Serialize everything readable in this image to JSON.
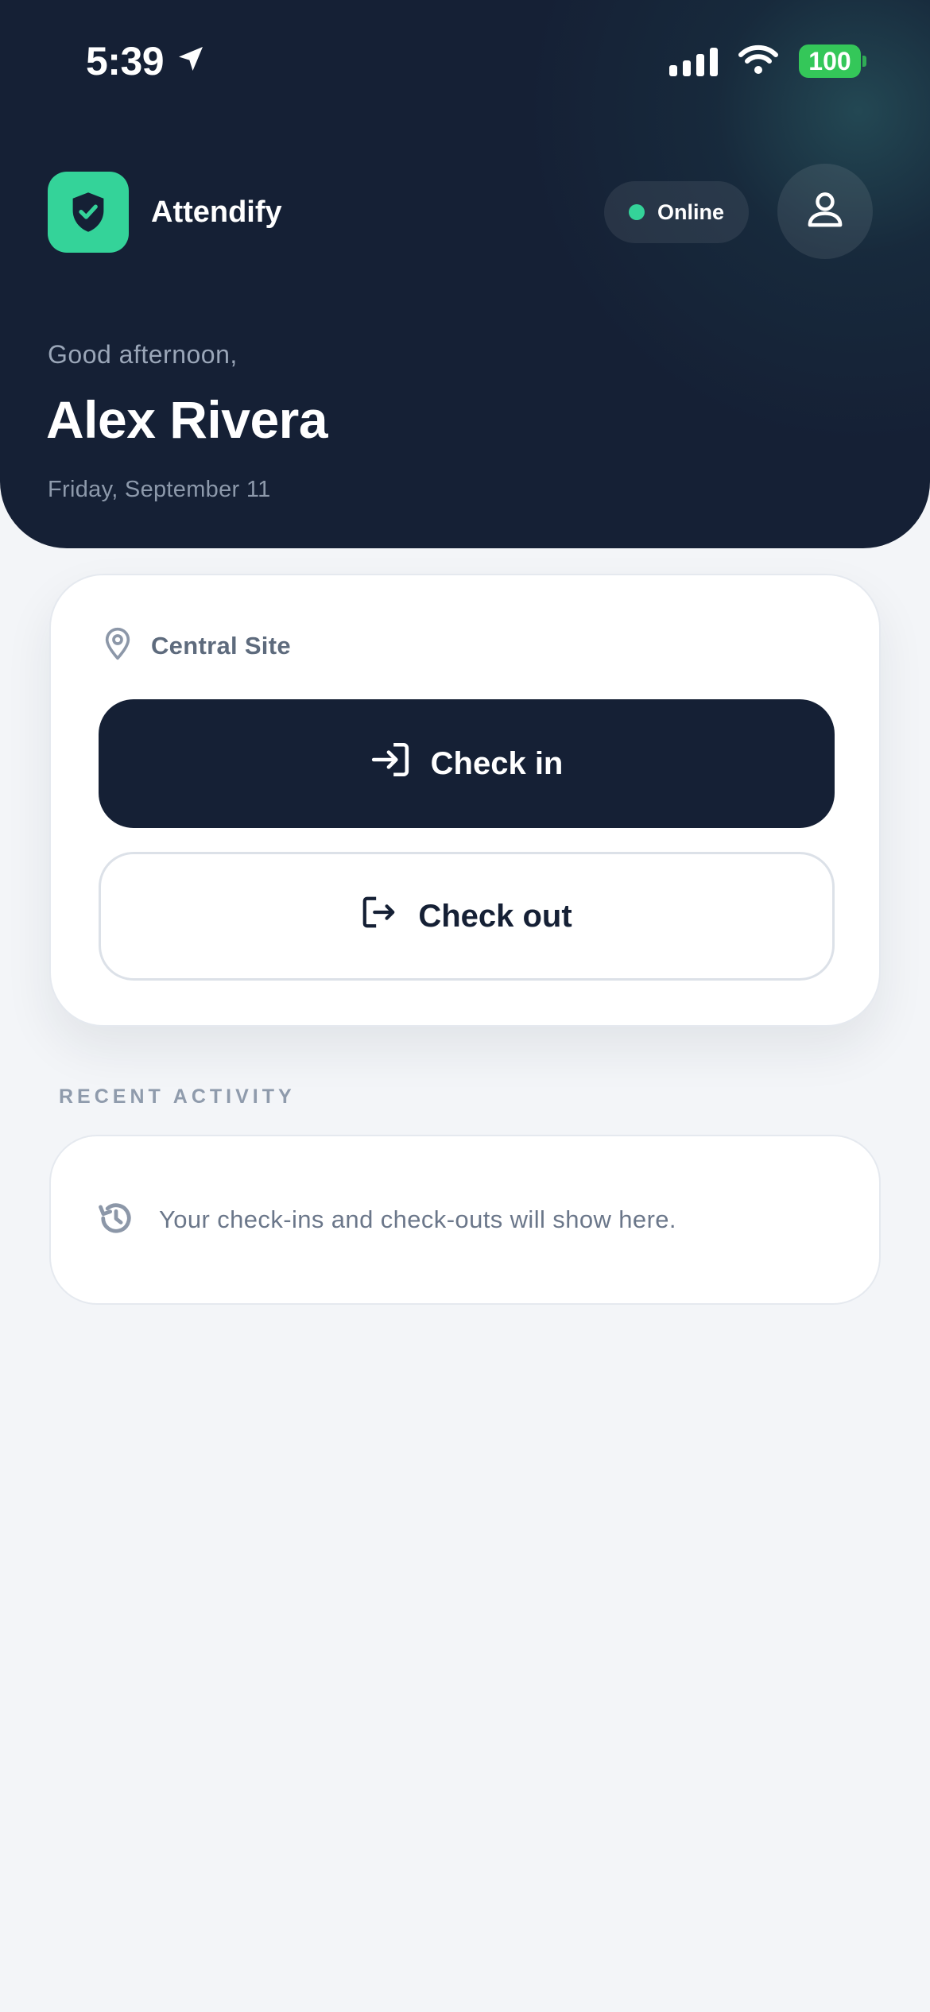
{
  "status_bar": {
    "time": "5:39",
    "battery": "100"
  },
  "header": {
    "app_name": "Attendify",
    "status_label": "Online",
    "greeting": "Good afternoon,",
    "user_name": "Alex Rivera",
    "date": "Friday, September 11"
  },
  "attendance": {
    "site": "Central Site",
    "check_in_label": "Check in",
    "check_out_label": "Check out"
  },
  "recent_activity": {
    "title": "RECENT ACTIVITY",
    "empty_message": "Your check-ins and check-outs will show here."
  },
  "colors": {
    "header_bg": "#152035",
    "accent": "#34d399",
    "battery": "#34c759",
    "page_bg": "#f3f5f8"
  },
  "icons": [
    "location-arrow-icon",
    "cellular-signal-icon",
    "wifi-icon",
    "battery-icon",
    "shield-check-icon",
    "user-icon",
    "map-pin-icon",
    "sign-in-icon",
    "sign-out-icon",
    "history-icon"
  ]
}
